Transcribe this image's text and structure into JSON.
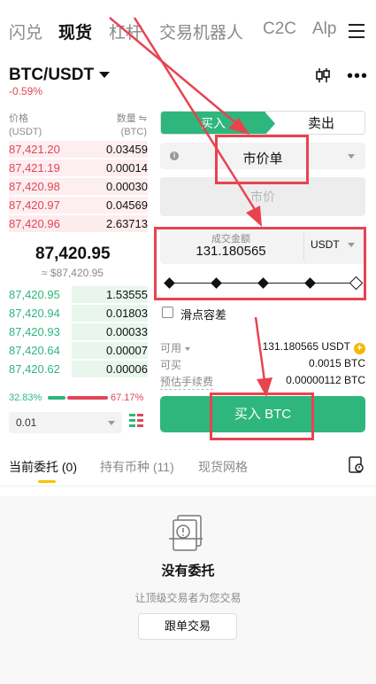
{
  "nav": {
    "tabs": [
      "闪兑",
      "现货",
      "杠杆",
      "交易机器人",
      "C2C",
      "Alp"
    ],
    "active_tab": "现货"
  },
  "pair": {
    "name": "BTC/USDT",
    "change": "-0.59%"
  },
  "orderbook": {
    "price_label": "价格",
    "price_unit": "(USDT)",
    "qty_label": "数量 ⇋",
    "qty_unit": "(BTC)",
    "asks": [
      {
        "price": "87,421.20",
        "qty": "0.03459",
        "depth": 0.25
      },
      {
        "price": "87,421.19",
        "qty": "0.00014",
        "depth": 0.05
      },
      {
        "price": "87,420.98",
        "qty": "0.00030",
        "depth": 0.06
      },
      {
        "price": "87,420.97",
        "qty": "0.04569",
        "depth": 0.3
      },
      {
        "price": "87,420.96",
        "qty": "2.63713",
        "depth": 1.0
      }
    ],
    "mid_price": "87,420.95",
    "mid_fiat": "≈ $87,420.95",
    "bids": [
      {
        "price": "87,420.95",
        "qty": "1.53555",
        "depth": 0.55
      },
      {
        "price": "87,420.94",
        "qty": "0.01803",
        "depth": 0.55
      },
      {
        "price": "87,420.93",
        "qty": "0.00033",
        "depth": 0.55
      },
      {
        "price": "87,420.64",
        "qty": "0.00007",
        "depth": 0.55
      },
      {
        "price": "87,420.62",
        "qty": "0.00006",
        "depth": 0.55
      }
    ],
    "buy_ratio": "32.83%",
    "sell_ratio": "67.17%",
    "depth_value": "0.01"
  },
  "form": {
    "buy_tab": "买入",
    "sell_tab": "卖出",
    "order_type": "市价单",
    "price_placeholder": "市价",
    "amount_label": "成交金额",
    "amount_value": "131.180565",
    "amount_unit": "USDT",
    "slippage_label": "滑点容差",
    "available_label": "可用",
    "available_value": "131.180565 USDT",
    "can_buy_label": "可买",
    "can_buy_value": "0.0015 BTC",
    "fee_label": "预估手续费",
    "fee_value": "0.00000112 BTC",
    "buy_button": "买入 BTC"
  },
  "bottom": {
    "tabs": [
      "当前委托 (0)",
      "持有币种 (11)",
      "现货网格"
    ],
    "empty_title": "没有委托",
    "empty_sub": "让顶级交易者为您交易",
    "follow_button": "跟单交易"
  },
  "colors": {
    "green": "#2eb67d",
    "red": "#e14658",
    "annotation": "#e8434f"
  }
}
